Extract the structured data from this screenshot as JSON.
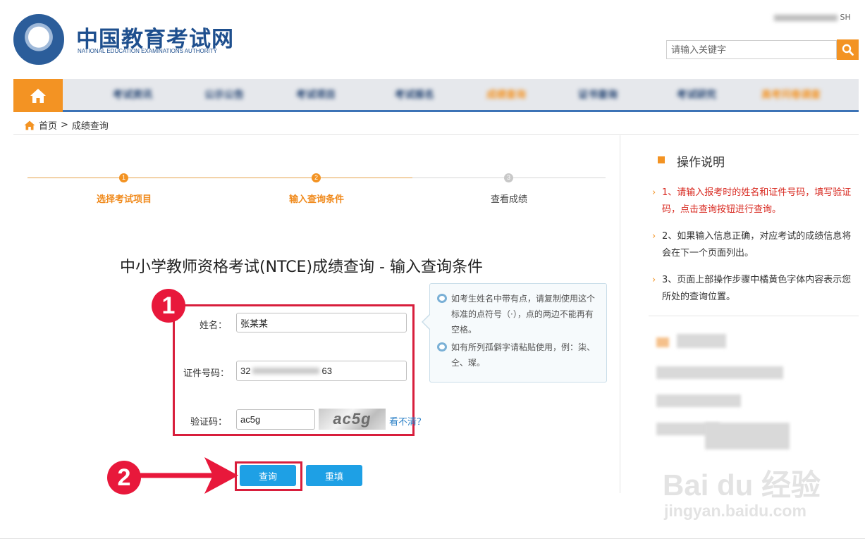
{
  "header": {
    "site_name_cn": "中国教育考试网",
    "site_name_en": "NATIONAL EDUCATION EXAMINATIONS AUTHORITY",
    "user_info": "SH",
    "search_placeholder": "请输入关键字"
  },
  "nav": {
    "items": [
      {
        "label": "考试资讯",
        "color": "#1e3f6e"
      },
      {
        "label": "公示公告",
        "color": "#1e3f6e"
      },
      {
        "label": "考试项目",
        "color": "#1e3f6e"
      },
      {
        "label": "考试报名",
        "color": "#1e3f6e"
      },
      {
        "label": "成绩查询",
        "color": "#f39323"
      },
      {
        "label": "证书查询",
        "color": "#1e3f6e"
      },
      {
        "label": "考试研究",
        "color": "#1e3f6e"
      },
      {
        "label": "高考问卷调查",
        "color": "#f39323"
      }
    ]
  },
  "breadcrumb": {
    "home": "首页",
    "separator": ">",
    "current": "成绩查询"
  },
  "steps": [
    {
      "num": "1",
      "label": "选择考试项目",
      "state": "done"
    },
    {
      "num": "2",
      "label": "输入查询条件",
      "state": "active"
    },
    {
      "num": "3",
      "label": "查看成绩",
      "state": "pending"
    }
  ],
  "form": {
    "title": "中小学教师资格考试(NTCE)成绩查询 - 输入查询条件",
    "name_label": "姓名：",
    "name_value": "张某某",
    "id_label": "证件号码：",
    "id_prefix": "32",
    "id_suffix": "63",
    "captcha_label": "验证码：",
    "captcha_value": "ac5g",
    "captcha_image_text": "ac5g",
    "refresh_link": "看不清？",
    "tips": [
      "如考生姓名中带有点，请复制使用这个标准的点符号（·），点的两边不能再有空格。",
      "如有所列孤僻字请粘贴使用，例：柒、仝、璨。"
    ],
    "submit_label": "查询",
    "reset_label": "重填"
  },
  "annotations": {
    "marker_1": "1",
    "marker_2": "2"
  },
  "sidebar": {
    "title": "操作说明",
    "items": [
      {
        "text": "1、请输入报考时的姓名和证件号码，填写验证码，点击查询按钮进行查询。",
        "color": "#d8281f"
      },
      {
        "text": "2、如果输入信息正确，对应考试的成绩信息将会在下一个页面列出。",
        "color": "#333333"
      },
      {
        "text": "3、页面上部操作步骤中橘黄色字体内容表示您所处的查询位置。",
        "color": "#333333"
      }
    ]
  },
  "watermark": {
    "brand": "Bai du 经验",
    "url": "jingyan.baidu.com"
  },
  "colors": {
    "accent_orange": "#f39323",
    "nav_blue": "#3c73b6",
    "button_blue": "#1ea0e5",
    "annotation_red": "#d81e3c"
  }
}
